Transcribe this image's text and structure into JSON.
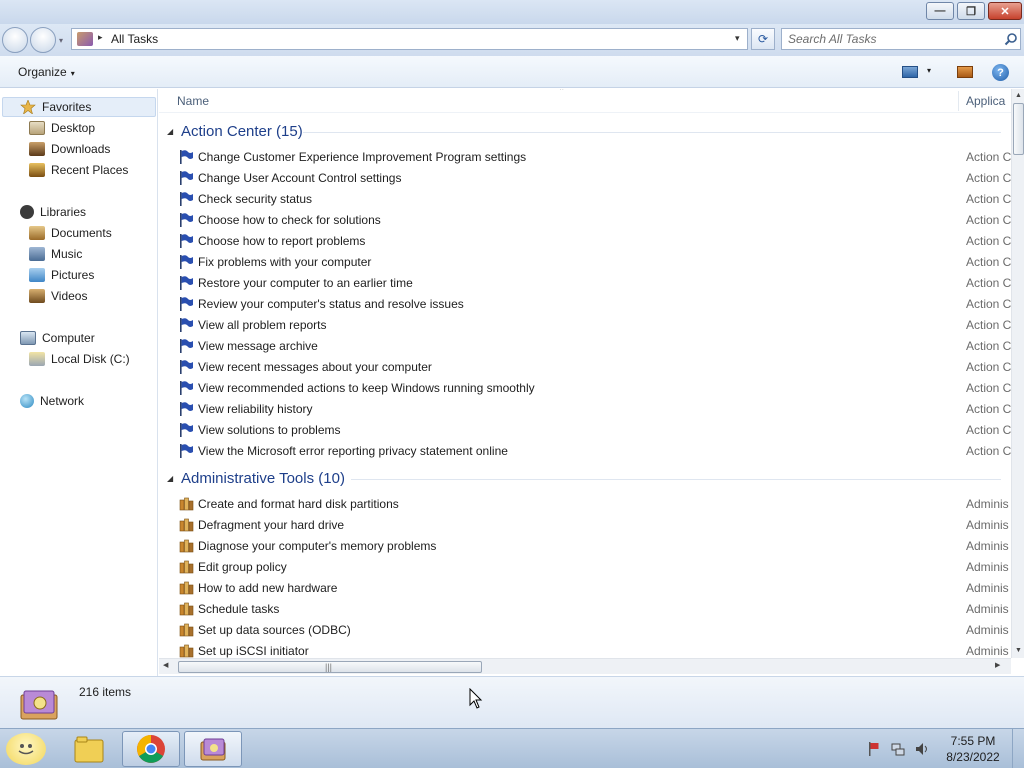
{
  "window": {
    "minimize_glyph": "—",
    "maximize_glyph": "❐",
    "close_glyph": "✕"
  },
  "address": {
    "separator": "▸",
    "path": "All Tasks",
    "dropdown": "▾",
    "refresh": "⟳"
  },
  "search": {
    "placeholder": "Search All Tasks"
  },
  "toolbar": {
    "organize": "Organize",
    "organize_arrow": "▾",
    "view_arrow": "▾",
    "help": "?"
  },
  "nav": {
    "favorites": "Favorites",
    "desktop": "Desktop",
    "downloads": "Downloads",
    "recent_places": "Recent Places",
    "libraries": "Libraries",
    "documents": "Documents",
    "music": "Music",
    "pictures": "Pictures",
    "videos": "Videos",
    "computer": "Computer",
    "local_disk": "Local Disk (C:)",
    "network": "Network"
  },
  "columns": {
    "name": "Name",
    "application": "Applica",
    "sort_arrow": "^"
  },
  "groups": [
    {
      "title": "Action Center (15)",
      "toggle": "◢",
      "items": [
        {
          "name": "Change Customer Experience Improvement Program settings",
          "app": "Action C"
        },
        {
          "name": "Change User Account Control settings",
          "app": "Action C"
        },
        {
          "name": "Check security status",
          "app": "Action C"
        },
        {
          "name": "Choose how to check for solutions",
          "app": "Action C"
        },
        {
          "name": "Choose how to report problems",
          "app": "Action C"
        },
        {
          "name": "Fix problems with your computer",
          "app": "Action C"
        },
        {
          "name": "Restore your computer to an earlier time",
          "app": "Action C"
        },
        {
          "name": "Review your computer's status and resolve issues",
          "app": "Action C"
        },
        {
          "name": "View all problem reports",
          "app": "Action C"
        },
        {
          "name": "View message archive",
          "app": "Action C"
        },
        {
          "name": "View recent messages about your computer",
          "app": "Action C"
        },
        {
          "name": "View recommended actions to keep Windows running smoothly",
          "app": "Action C"
        },
        {
          "name": "View reliability history",
          "app": "Action C"
        },
        {
          "name": "View solutions to problems",
          "app": "Action C"
        },
        {
          "name": "View the Microsoft error reporting privacy statement online",
          "app": "Action C"
        }
      ]
    },
    {
      "title": "Administrative Tools (10)",
      "toggle": "◢",
      "items": [
        {
          "name": "Create and format hard disk partitions",
          "app": "Adminis"
        },
        {
          "name": "Defragment your hard drive",
          "app": "Adminis"
        },
        {
          "name": "Diagnose your computer's memory problems",
          "app": "Adminis"
        },
        {
          "name": "Edit group policy",
          "app": "Adminis"
        },
        {
          "name": "How to add new hardware",
          "app": "Adminis"
        },
        {
          "name": "Schedule tasks",
          "app": "Adminis"
        },
        {
          "name": "Set up data sources (ODBC)",
          "app": "Adminis"
        },
        {
          "name": "Set up iSCSI initiator",
          "app": "Adminis"
        }
      ]
    }
  ],
  "scroll": {
    "up": "▲",
    "down": "▼",
    "left": "◀",
    "right": "▶",
    "grip": "|||"
  },
  "details": {
    "item_count": "216 items"
  },
  "taskbar": {
    "time": "7:55 PM",
    "date": "8/23/2022"
  },
  "icons": {
    "flag": "blue-flag-icon",
    "admin": "admin-tools-icon",
    "god_mode": "god-mode-folder-icon"
  },
  "colors": {
    "group_title": "#1e3f8a",
    "flag_blue": "#2a4fb0",
    "selection": "#e5eef9"
  }
}
